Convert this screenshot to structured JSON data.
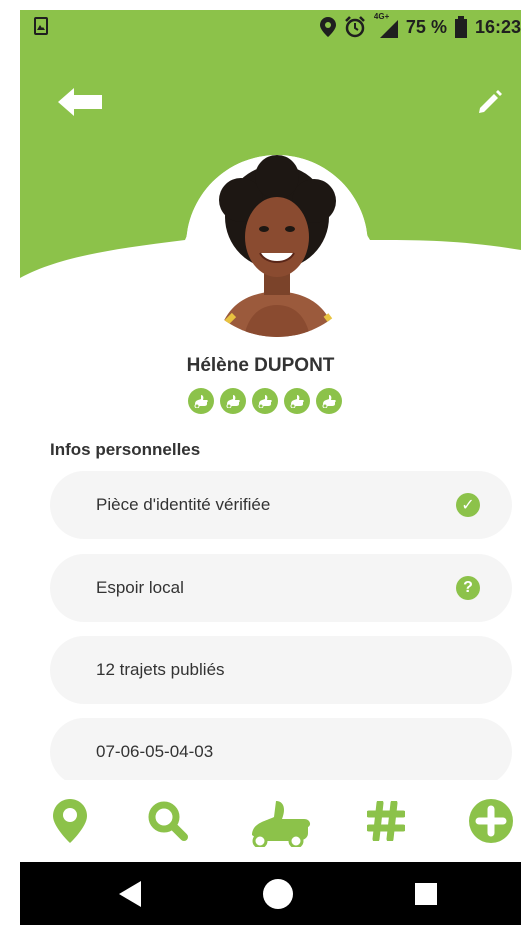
{
  "status_bar": {
    "battery_percent": "75 %",
    "time": "16:23",
    "network_label": "4G+",
    "icons": [
      "image-notification-icon",
      "location-pin-icon",
      "alarm-clock-icon",
      "signal-icon",
      "battery-icon"
    ]
  },
  "colors": {
    "brand_green": "#8cc24a",
    "text_dark": "#333333",
    "item_bg": "#f5f5f5",
    "nav_bar": "#000000"
  },
  "header": {
    "back_icon": "back-arrow-icon",
    "edit_icon": "edit-pencil-icon"
  },
  "profile": {
    "name": "Hélène DUPONT",
    "rating_count": 5,
    "rating_icon": "thumbs-up-car-icon"
  },
  "section": {
    "title": "Infos personnelles"
  },
  "info_items": [
    {
      "label": "Pièce d'identité vérifiée",
      "status_icon": "check-circle-icon",
      "status_glyph": "✓"
    },
    {
      "label": "Espoir local",
      "status_icon": "question-circle-icon",
      "status_glyph": "?"
    },
    {
      "label": "12 trajets publiés"
    },
    {
      "label": "07-06-05-04-03"
    }
  ],
  "bottom_nav": [
    {
      "name": "map-pin-icon"
    },
    {
      "name": "search-icon"
    },
    {
      "name": "thumbs-up-car-icon"
    },
    {
      "name": "hashtag-icon"
    },
    {
      "name": "plus-circle-icon"
    }
  ],
  "android_nav": [
    {
      "name": "back-triangle-icon"
    },
    {
      "name": "home-circle-icon"
    },
    {
      "name": "recents-square-icon"
    }
  ]
}
